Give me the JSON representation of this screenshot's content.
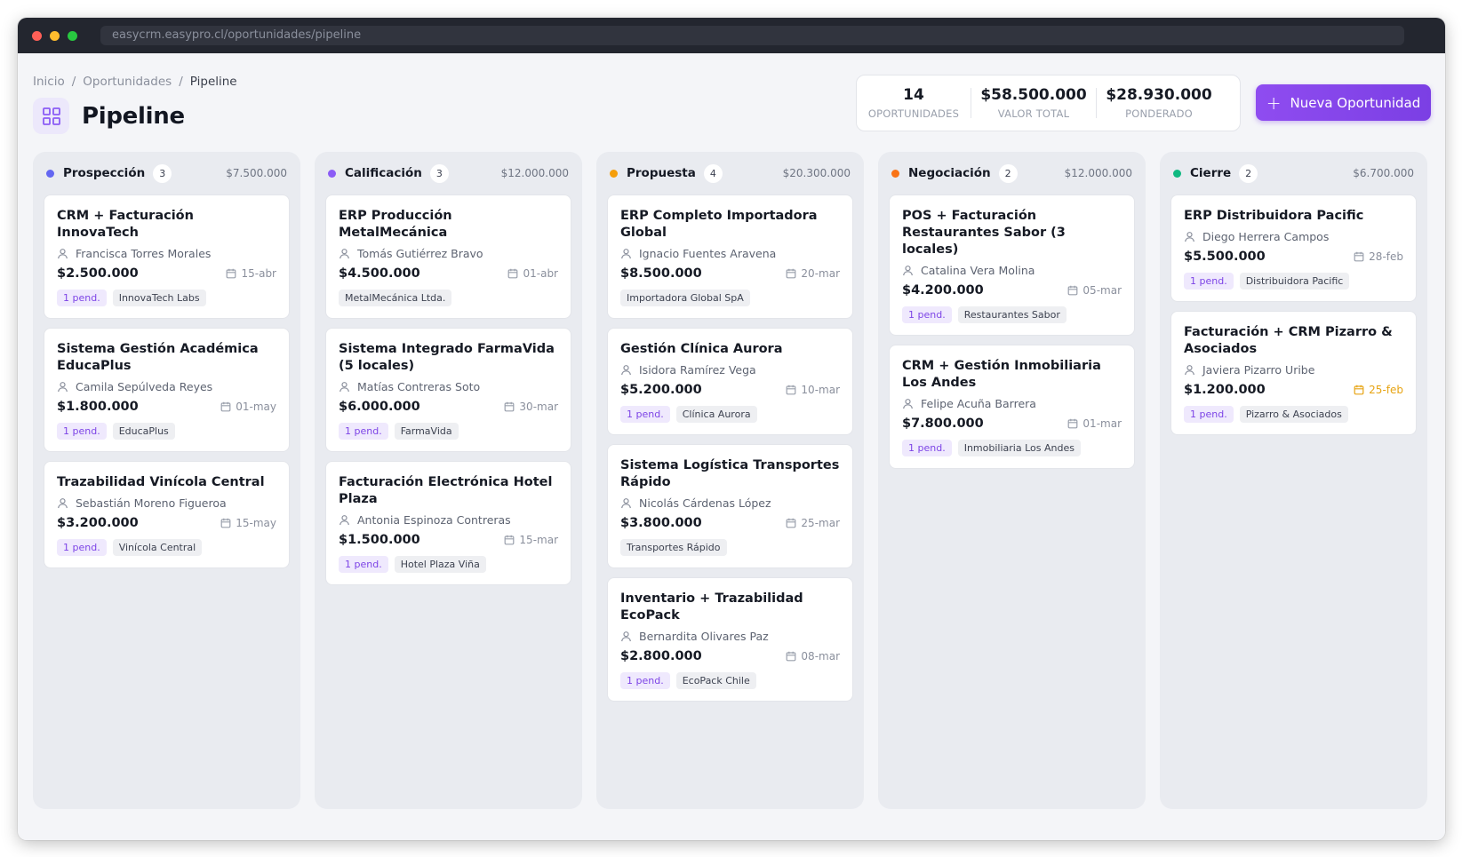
{
  "browser": {
    "url": "easycrm.easypro.cl/oportunidades/pipeline"
  },
  "breadcrumb": [
    "Inicio",
    "Oportunidades",
    "Pipeline"
  ],
  "page_title": "Pipeline",
  "stats": [
    {
      "value": "14",
      "label": "OPORTUNIDADES"
    },
    {
      "value": "$58.500.000",
      "label": "VALOR TOTAL"
    },
    {
      "value": "$28.930.000",
      "label": "PONDERADO"
    }
  ],
  "new_button": {
    "label": "Nueva Oportunidad"
  },
  "colors": {
    "accent": "#7b3fe4",
    "warning": "#e7a413"
  },
  "columns": [
    {
      "name": "Prospección",
      "count": "3",
      "total": "$7.500.000",
      "color": "#6366f1",
      "cards": [
        {
          "title": "CRM + Facturación InnovaTech",
          "contact": "Francisca Torres Morales",
          "amount": "$2.500.000",
          "date": "15-abr",
          "pending": "1 pend.",
          "company": "InnovaTech Labs"
        },
        {
          "title": "Sistema Gestión Académica EducaPlus",
          "contact": "Camila Sepúlveda Reyes",
          "amount": "$1.800.000",
          "date": "01-may",
          "pending": "1 pend.",
          "company": "EducaPlus"
        },
        {
          "title": "Trazabilidad Vinícola Central",
          "contact": "Sebastián Moreno Figueroa",
          "amount": "$3.200.000",
          "date": "15-may",
          "pending": "1 pend.",
          "company": "Vinícola Central"
        }
      ]
    },
    {
      "name": "Calificación",
      "count": "3",
      "total": "$12.000.000",
      "color": "#8b5cf6",
      "cards": [
        {
          "title": "ERP Producción MetalMecánica",
          "contact": "Tomás Gutiérrez Bravo",
          "amount": "$4.500.000",
          "date": "01-abr",
          "pending": "",
          "company": "MetalMecánica Ltda."
        },
        {
          "title": "Sistema Integrado FarmaVida (5 locales)",
          "contact": "Matías Contreras Soto",
          "amount": "$6.000.000",
          "date": "30-mar",
          "pending": "1 pend.",
          "company": "FarmaVida"
        },
        {
          "title": "Facturación Electrónica Hotel Plaza",
          "contact": "Antonia Espinoza Contreras",
          "amount": "$1.500.000",
          "date": "15-mar",
          "pending": "1 pend.",
          "company": "Hotel Plaza Viña"
        }
      ]
    },
    {
      "name": "Propuesta",
      "count": "4",
      "total": "$20.300.000",
      "color": "#f59e0b",
      "cards": [
        {
          "title": "ERP Completo Importadora Global",
          "contact": "Ignacio Fuentes Aravena",
          "amount": "$8.500.000",
          "date": "20-mar",
          "pending": "",
          "company": "Importadora Global SpA"
        },
        {
          "title": "Gestión Clínica Aurora",
          "contact": "Isidora Ramírez Vega",
          "amount": "$5.200.000",
          "date": "10-mar",
          "pending": "1 pend.",
          "company": "Clínica Aurora"
        },
        {
          "title": "Sistema Logística Transportes Rápido",
          "contact": "Nicolás Cárdenas López",
          "amount": "$3.800.000",
          "date": "25-mar",
          "pending": "",
          "company": "Transportes Rápido"
        },
        {
          "title": "Inventario + Trazabilidad EcoPack",
          "contact": "Bernardita Olivares Paz",
          "amount": "$2.800.000",
          "date": "08-mar",
          "pending": "1 pend.",
          "company": "EcoPack Chile"
        }
      ]
    },
    {
      "name": "Negociación",
      "count": "2",
      "total": "$12.000.000",
      "color": "#f97316",
      "cards": [
        {
          "title": "POS + Facturación Restaurantes Sabor (3 locales)",
          "contact": "Catalina Vera Molina",
          "amount": "$4.200.000",
          "date": "05-mar",
          "pending": "1 pend.",
          "company": "Restaurantes Sabor"
        },
        {
          "title": "CRM + Gestión Inmobiliaria Los Andes",
          "contact": "Felipe Acuña Barrera",
          "amount": "$7.800.000",
          "date": "01-mar",
          "pending": "1 pend.",
          "company": "Inmobiliaria Los Andes"
        }
      ]
    },
    {
      "name": "Cierre",
      "count": "2",
      "total": "$6.700.000",
      "color": "#10b981",
      "cards": [
        {
          "title": "ERP Distribuidora Pacific",
          "contact": "Diego Herrera Campos",
          "amount": "$5.500.000",
          "date": "28-feb",
          "pending": "1 pend.",
          "company": "Distribuidora Pacific"
        },
        {
          "title": "Facturación + CRM Pizarro & Asociados",
          "contact": "Javiera Pizarro Uribe",
          "amount": "$1.200.000",
          "date": "25-feb",
          "date_warning": true,
          "pending": "1 pend.",
          "company": "Pizarro & Asociados"
        }
      ]
    }
  ]
}
